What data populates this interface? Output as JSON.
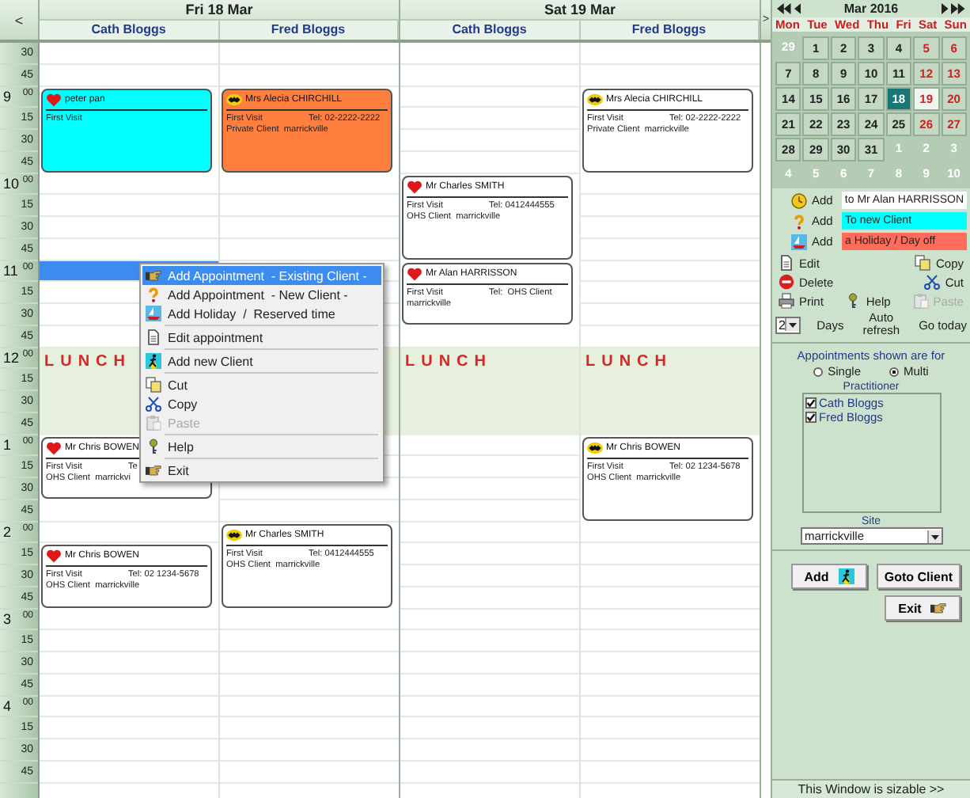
{
  "grid": {
    "prev": "<",
    "next": ">",
    "days": [
      {
        "label": "Fri 18 Mar",
        "columns": [
          {
            "name": "Cath Bloggs",
            "lunch_label": "LUNCH",
            "slots": [
              {
                "kind": "free"
              },
              {
                "kind": "free"
              },
              {
                "kind": "booked",
                "appointment": {
                  "kind": "heart",
                  "color": "#00ffff",
                  "name": "peter pan",
                  "visit": "First Visit"
                }
              },
              {
                "kind": "booked"
              },
              {
                "kind": "booked"
              },
              {
                "kind": "booked"
              },
              {
                "kind": "free"
              },
              {
                "kind": "free"
              },
              {
                "kind": "free"
              },
              {
                "kind": "free"
              },
              {
                "kind": "selected"
              },
              {
                "kind": "free"
              },
              {
                "kind": "free"
              },
              {
                "kind": "free"
              },
              {
                "kind": "lunch"
              },
              {
                "kind": "lunch"
              },
              {
                "kind": "lunch"
              },
              {
                "kind": "lunch"
              },
              {
                "kind": "booked",
                "appointment": {
                  "kind": "heart",
                  "color": "#ffffff",
                  "name": "Mr Chris BOWEN",
                  "visit": "First Visit",
                  "tel": "Te",
                  "detail": "OHS Client  marrickvi"
                }
              },
              {
                "kind": "booked"
              },
              {
                "kind": "booked"
              },
              {
                "kind": "free"
              },
              {
                "kind": "free"
              },
              {
                "kind": "booked",
                "appointment": {
                  "kind": "heart",
                  "color": "#ffffff",
                  "name": "Mr Chris BOWEN",
                  "visit": "First Visit",
                  "tel": "Tel: 02 1234-5678",
                  "detail": "OHS Client  marrickville"
                }
              },
              {
                "kind": "booked"
              },
              {
                "kind": "booked"
              },
              {
                "kind": "free"
              },
              {
                "kind": "free"
              },
              {
                "kind": "free"
              },
              {
                "kind": "free"
              },
              {
                "kind": "free"
              },
              {
                "kind": "free"
              },
              {
                "kind": "free"
              },
              {
                "kind": "free"
              }
            ]
          },
          {
            "name": "Fred Bloggs",
            "slots": [
              {
                "kind": "free"
              },
              {
                "kind": "free"
              },
              {
                "kind": "booked",
                "appointment": {
                  "kind": "emblem",
                  "color": "#ff7f3f",
                  "name": "Mrs Alecia CHIRCHILL",
                  "visit": "First Visit",
                  "tel": "Tel: 02-2222-2222",
                  "detail": "Private Client  marrickville"
                }
              },
              {
                "kind": "booked"
              },
              {
                "kind": "booked"
              },
              {
                "kind": "booked"
              },
              {
                "kind": "free"
              },
              {
                "kind": "free"
              },
              {
                "kind": "free"
              },
              {
                "kind": "free"
              },
              {
                "kind": "free"
              },
              {
                "kind": "free"
              },
              {
                "kind": "free"
              },
              {
                "kind": "free"
              },
              {
                "kind": "lunch"
              },
              {
                "kind": "lunch"
              },
              {
                "kind": "lunch"
              },
              {
                "kind": "lunch"
              },
              {
                "kind": "free"
              },
              {
                "kind": "free"
              },
              {
                "kind": "free"
              },
              {
                "kind": "free"
              },
              {
                "kind": "booked",
                "appointment": {
                  "kind": "emblem",
                  "color": "#ffffff",
                  "name": "Mr Charles SMITH",
                  "visit": "First Visit",
                  "tel": "Tel: 0412444555",
                  "detail": "OHS Client  marrickville"
                }
              },
              {
                "kind": "booked"
              },
              {
                "kind": "booked"
              },
              {
                "kind": "booked"
              },
              {
                "kind": "free"
              },
              {
                "kind": "free"
              },
              {
                "kind": "free"
              },
              {
                "kind": "free"
              },
              {
                "kind": "free"
              },
              {
                "kind": "free"
              },
              {
                "kind": "free"
              },
              {
                "kind": "free"
              }
            ]
          }
        ]
      },
      {
        "label": "Sat 19 Mar",
        "columns": [
          {
            "name": "Cath Bloggs",
            "lunch_label": "LUNCH",
            "slots": [
              {
                "kind": "free"
              },
              {
                "kind": "free"
              },
              {
                "kind": "free"
              },
              {
                "kind": "free"
              },
              {
                "kind": "free"
              },
              {
                "kind": "free"
              },
              {
                "kind": "booked",
                "appointment": {
                  "kind": "heart",
                  "color": "#ffffff",
                  "name": "Mr Charles SMITH",
                  "visit": "First Visit",
                  "tel": "Tel: 0412444555",
                  "detail": "OHS Client  marrickville"
                }
              },
              {
                "kind": "booked"
              },
              {
                "kind": "booked"
              },
              {
                "kind": "booked"
              },
              {
                "kind": "booked",
                "appointment": {
                  "kind": "heart",
                  "color": "#ffffff",
                  "name": "Mr Alan HARRISSON",
                  "visit": "First Visit",
                  "tel": "Tel:  OHS Client",
                  "detail": "marrickville"
                }
              },
              {
                "kind": "booked"
              },
              {
                "kind": "booked"
              },
              {
                "kind": "free"
              },
              {
                "kind": "lunch"
              },
              {
                "kind": "lunch"
              },
              {
                "kind": "lunch"
              },
              {
                "kind": "lunch"
              },
              {
                "kind": "free"
              },
              {
                "kind": "free"
              },
              {
                "kind": "free"
              },
              {
                "kind": "free"
              },
              {
                "kind": "free"
              },
              {
                "kind": "free"
              },
              {
                "kind": "free"
              },
              {
                "kind": "free"
              },
              {
                "kind": "free"
              },
              {
                "kind": "free"
              },
              {
                "kind": "free"
              },
              {
                "kind": "free"
              },
              {
                "kind": "free"
              },
              {
                "kind": "free"
              },
              {
                "kind": "free"
              },
              {
                "kind": "free"
              }
            ]
          },
          {
            "name": "Fred Bloggs",
            "lunch_label": "LUNCH",
            "slots": [
              {
                "kind": "free"
              },
              {
                "kind": "free"
              },
              {
                "kind": "booked",
                "appointment": {
                  "kind": "emblem",
                  "color": "#ffffff",
                  "name": "Mrs Alecia CHIRCHILL",
                  "visit": "First Visit",
                  "tel": "Tel: 02-2222-2222",
                  "detail": "Private Client  marrickville"
                }
              },
              {
                "kind": "booked"
              },
              {
                "kind": "booked"
              },
              {
                "kind": "booked"
              },
              {
                "kind": "free"
              },
              {
                "kind": "free"
              },
              {
                "kind": "free"
              },
              {
                "kind": "free"
              },
              {
                "kind": "free"
              },
              {
                "kind": "free"
              },
              {
                "kind": "free"
              },
              {
                "kind": "free"
              },
              {
                "kind": "lunch"
              },
              {
                "kind": "lunch"
              },
              {
                "kind": "lunch"
              },
              {
                "kind": "lunch"
              },
              {
                "kind": "booked",
                "appointment": {
                  "kind": "emblem",
                  "color": "#ffffff",
                  "name": "Mr Chris BOWEN",
                  "visit": "First Visit",
                  "tel": "Tel: 02 1234-5678",
                  "detail": "OHS Client  marrickville"
                }
              },
              {
                "kind": "booked"
              },
              {
                "kind": "booked"
              },
              {
                "kind": "booked"
              },
              {
                "kind": "free"
              },
              {
                "kind": "free"
              },
              {
                "kind": "free"
              },
              {
                "kind": "free"
              },
              {
                "kind": "free"
              },
              {
                "kind": "free"
              },
              {
                "kind": "free"
              },
              {
                "kind": "free"
              },
              {
                "kind": "free"
              },
              {
                "kind": "free"
              },
              {
                "kind": "free"
              },
              {
                "kind": "free"
              }
            ]
          }
        ]
      }
    ],
    "time_rows": [
      {
        "minute": "30"
      },
      {
        "minute": "45"
      },
      {
        "hour": "9",
        "minute": "00"
      },
      {
        "minute": "15"
      },
      {
        "minute": "30"
      },
      {
        "minute": "45"
      },
      {
        "hour": "10",
        "minute": "00"
      },
      {
        "minute": "15"
      },
      {
        "minute": "30"
      },
      {
        "minute": "45"
      },
      {
        "hour": "11",
        "minute": "00"
      },
      {
        "minute": "15"
      },
      {
        "minute": "30"
      },
      {
        "minute": "45"
      },
      {
        "hour": "12",
        "minute": "00"
      },
      {
        "minute": "15"
      },
      {
        "minute": "30"
      },
      {
        "minute": "45"
      },
      {
        "hour": "1",
        "minute": "00"
      },
      {
        "minute": "15"
      },
      {
        "minute": "30"
      },
      {
        "minute": "45"
      },
      {
        "hour": "2",
        "minute": "00"
      },
      {
        "minute": "15"
      },
      {
        "minute": "30"
      },
      {
        "minute": "45"
      },
      {
        "hour": "3",
        "minute": "00"
      },
      {
        "minute": "15"
      },
      {
        "minute": "30"
      },
      {
        "minute": "45"
      },
      {
        "hour": "4",
        "minute": "00"
      },
      {
        "minute": "15"
      },
      {
        "minute": "30"
      },
      {
        "minute": "45"
      }
    ]
  },
  "context_menu": [
    {
      "kind": "item",
      "label": "Add Appointment  - Existing Client -",
      "selected": true,
      "disabled": false
    },
    {
      "kind": "item",
      "label": "Add Appointment  - New Client -",
      "selected": false,
      "disabled": false
    },
    {
      "kind": "item",
      "label": "Add Holiday  /  Reserved time",
      "selected": false,
      "disabled": false
    },
    {
      "kind": "separator"
    },
    {
      "kind": "item",
      "label": "Edit appointment",
      "selected": false,
      "disabled": false
    },
    {
      "kind": "separator"
    },
    {
      "kind": "item",
      "label": "Add new Client",
      "selected": false,
      "disabled": false
    },
    {
      "kind": "separator"
    },
    {
      "kind": "item",
      "label": "Cut",
      "selected": false,
      "disabled": false
    },
    {
      "kind": "item",
      "label": "Copy",
      "selected": false,
      "disabled": false
    },
    {
      "kind": "item",
      "label": "Paste",
      "selected": false,
      "disabled": true
    },
    {
      "kind": "separator"
    },
    {
      "kind": "item",
      "label": "Help",
      "selected": false,
      "disabled": false
    },
    {
      "kind": "separator"
    },
    {
      "kind": "item",
      "label": "Exit",
      "selected": false,
      "disabled": false
    }
  ],
  "panel": {
    "calendar": {
      "month": "Mar 2016",
      "weekdays": [
        "Mon",
        "Tue",
        "Wed",
        "Thu",
        "Fri",
        "Sat",
        "Sun"
      ],
      "days": [
        {
          "day": "29",
          "in_month": false,
          "selected": false,
          "today": false
        },
        {
          "day": "1",
          "in_month": true,
          "selected": false,
          "today": false
        },
        {
          "day": "2",
          "in_month": true,
          "selected": false,
          "today": false
        },
        {
          "day": "3",
          "in_month": true,
          "selected": false,
          "today": false
        },
        {
          "day": "4",
          "in_month": true,
          "selected": false,
          "today": false
        },
        {
          "day": "5",
          "in_month": true,
          "selected": false,
          "today": false
        },
        {
          "day": "6",
          "in_month": true,
          "selected": false,
          "today": false
        },
        {
          "day": "7",
          "in_month": true,
          "selected": false,
          "today": false
        },
        {
          "day": "8",
          "in_month": true,
          "selected": false,
          "today": false
        },
        {
          "day": "9",
          "in_month": true,
          "selected": false,
          "today": false
        },
        {
          "day": "10",
          "in_month": true,
          "selected": false,
          "today": false
        },
        {
          "day": "11",
          "in_month": true,
          "selected": false,
          "today": false
        },
        {
          "day": "12",
          "in_month": true,
          "selected": false,
          "today": false
        },
        {
          "day": "13",
          "in_month": true,
          "selected": false,
          "today": false
        },
        {
          "day": "14",
          "in_month": true,
          "selected": false,
          "today": false
        },
        {
          "day": "15",
          "in_month": true,
          "selected": false,
          "today": false
        },
        {
          "day": "16",
          "in_month": true,
          "selected": false,
          "today": false
        },
        {
          "day": "17",
          "in_month": true,
          "selected": false,
          "today": false
        },
        {
          "day": "18",
          "in_month": true,
          "selected": true,
          "today": false
        },
        {
          "day": "19",
          "in_month": true,
          "selected": false,
          "today": true
        },
        {
          "day": "20",
          "in_month": true,
          "selected": false,
          "today": false
        },
        {
          "day": "21",
          "in_month": true,
          "selected": false,
          "today": false
        },
        {
          "day": "22",
          "in_month": true,
          "selected": false,
          "today": false
        },
        {
          "day": "23",
          "in_month": true,
          "selected": false,
          "today": false
        },
        {
          "day": "24",
          "in_month": true,
          "selected": false,
          "today": false
        },
        {
          "day": "25",
          "in_month": true,
          "selected": false,
          "today": false
        },
        {
          "day": "26",
          "in_month": true,
          "selected": false,
          "today": false
        },
        {
          "day": "27",
          "in_month": true,
          "selected": false,
          "today": false
        },
        {
          "day": "28",
          "in_month": true,
          "selected": false,
          "today": false
        },
        {
          "day": "29",
          "in_month": true,
          "selected": false,
          "today": false
        },
        {
          "day": "30",
          "in_month": true,
          "selected": false,
          "today": false
        },
        {
          "day": "31",
          "in_month": true,
          "selected": false,
          "today": false
        },
        {
          "day": "1",
          "in_month": false,
          "selected": false,
          "today": false
        },
        {
          "day": "2",
          "in_month": false,
          "selected": false,
          "today": false
        },
        {
          "day": "3",
          "in_month": false,
          "selected": false,
          "today": false
        },
        {
          "day": "4",
          "in_month": false,
          "selected": false,
          "today": false
        },
        {
          "day": "5",
          "in_month": false,
          "selected": false,
          "today": false
        },
        {
          "day": "6",
          "in_month": false,
          "selected": false,
          "today": false
        },
        {
          "day": "7",
          "in_month": false,
          "selected": false,
          "today": false
        },
        {
          "day": "8",
          "in_month": false,
          "selected": false,
          "today": false
        },
        {
          "day": "9",
          "in_month": false,
          "selected": false,
          "today": false
        },
        {
          "day": "10",
          "in_month": false,
          "selected": false,
          "today": false
        }
      ]
    },
    "add_rows": [
      {
        "kind": "clock",
        "label": "Add",
        "target": "to Mr Alan HARRISSON",
        "color": "#ffffff"
      },
      {
        "kind": "question",
        "label": "Add",
        "target": "To new Client",
        "color": "#00ffff"
      },
      {
        "kind": "boat",
        "label": "Add",
        "target": "a Holiday / Day off",
        "color": "#ff6c5c"
      }
    ],
    "tool_rows": [
      [
        {
          "kind": "document",
          "label": "Edit",
          "disabled": false
        },
        {
          "kind": "pages",
          "label": "Copy",
          "disabled": false
        }
      ],
      [
        {
          "kind": "stop",
          "label": "Delete",
          "disabled": false
        },
        {
          "kind": "scissors",
          "label": "Cut",
          "disabled": false
        }
      ],
      [
        {
          "kind": "printer",
          "label": "Print",
          "disabled": false
        },
        {
          "kind": "key",
          "label": "Help",
          "disabled": false
        },
        {
          "kind": "clipboard",
          "label": "Paste",
          "disabled": true
        }
      ]
    ],
    "days_select": "2",
    "days_label": "Days",
    "auto_refresh": "Auto refresh",
    "go_today": "Go today",
    "shown_for": "Appointments shown are for",
    "modes": [
      {
        "label": "Single",
        "selected": false
      },
      {
        "label": "Multi",
        "selected": true
      }
    ],
    "practitioner_label": "Practitioner",
    "practitioners": [
      {
        "name": "Cath Bloggs",
        "checked": true
      },
      {
        "name": "Fred Bloggs",
        "checked": true
      }
    ],
    "site_label": "Site",
    "site": "marrickville",
    "add_button": "Add",
    "goto_button": "Goto Client",
    "exit_button": "Exit",
    "status": "This Window is sizable  >>"
  }
}
